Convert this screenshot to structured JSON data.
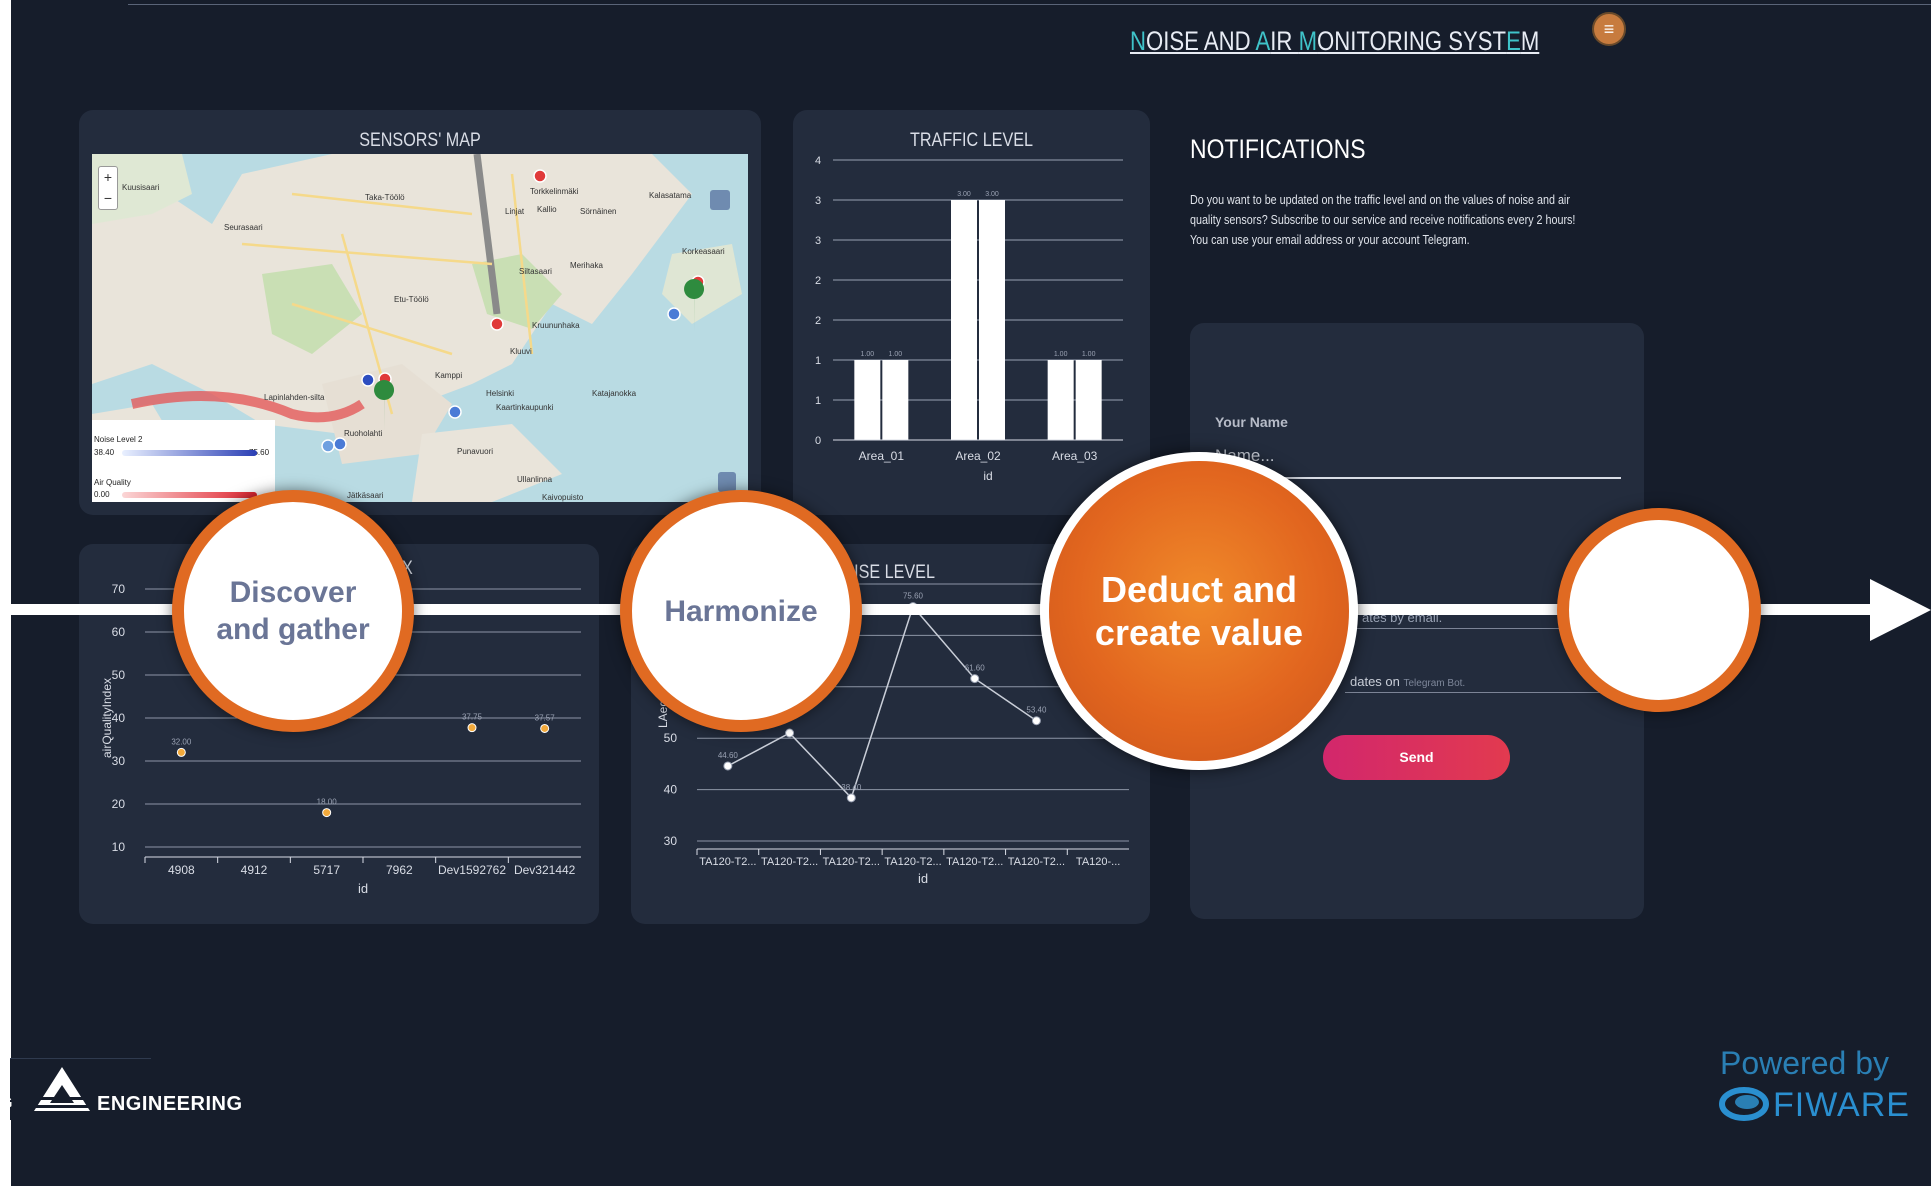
{
  "header": {
    "title_parts": [
      "",
      "N",
      "OISE AND ",
      "A",
      "IR ",
      "M",
      "ONITORING SYST",
      "E",
      "M"
    ],
    "menu_icon": "menu-icon"
  },
  "map_card": {
    "title": "SENSORS' MAP",
    "zoom_in": "+",
    "zoom_out": "−",
    "labels": [
      "Kuusisaari",
      "Taka-Töölö",
      "Torkkelinmäki",
      "Kalasatama",
      "Linjat",
      "Kallio",
      "Sörnäinen",
      "Seurasaari",
      "Etu-Töölö",
      "Siltasaari",
      "Merihaka",
      "Kruununhaka",
      "Kluuvi",
      "Kamppi",
      "Helsinki",
      "Katajanokka",
      "Kaartinkaupunki",
      "Lapinlahden-silta",
      "Ruoholahti",
      "Punavuori",
      "Ullanlinna",
      "Jätkäsaari",
      "Kaivopuisto",
      "Korkeasaari"
    ],
    "legend": {
      "noise_label": "Noise Level 2",
      "noise_min": "38.40",
      "noise_max": "75.60",
      "air_label": "Air Quality",
      "air_min": "0.00"
    }
  },
  "traffic_card": {
    "title": "TRAFFIC LEVEL",
    "xlabel": "id"
  },
  "air_card": {
    "title_visible": "X",
    "xlabel": "id",
    "ylabel": "airQualityIndex"
  },
  "noise_card": {
    "title_visible": "ISE LEVEL",
    "xlabel": "id",
    "ylabel": "LAeq"
  },
  "notifications": {
    "title": "NOTIFICATIONS",
    "text": "Do you want to be updated on the traffic level and on the values of noise and air quality sensors? Subscribe to our service and receive notifications every 2 hours! You can use your email address or your account Telegram.",
    "name_label": "Your Name",
    "name_placeholder": "Name...",
    "email_option": "ates by email.",
    "telegram_option": "dates on",
    "telegram_hint": "Telegram Bot.",
    "send": "Send"
  },
  "process": {
    "step1": "Discover and gather",
    "step2": "Harmonize",
    "step3": "Deduct and create value",
    "step4": ""
  },
  "footer": {
    "engineering": "ENGINEERING",
    "engineering_left": "G",
    "powered_by": "Powered by",
    "fiware": "FIWARE"
  },
  "chart_data": [
    {
      "type": "bar",
      "title": "TRAFFIC LEVEL",
      "xlabel": "id",
      "categories": [
        "Area_01",
        "Area_02",
        "Area_03"
      ],
      "series": [
        {
          "values": [
            1.0,
            3.0,
            1.0
          ]
        },
        {
          "values": [
            1.0,
            3.0,
            1.0
          ]
        }
      ],
      "data_labels": [
        "1.00",
        "1.00",
        "3.00",
        "3.00",
        "1.00",
        "1.00"
      ],
      "yticks": [
        "0",
        "1",
        "1",
        "2",
        "2",
        "3",
        "3",
        "4"
      ],
      "ylim": [
        0,
        3.5
      ]
    },
    {
      "type": "scatter",
      "xlabel": "id",
      "ylabel": "airQualityIndex",
      "categories": [
        "4908",
        "4912",
        "5717",
        "7962",
        "Dev1592762",
        "Dev321442"
      ],
      "values": [
        32.0,
        null,
        18.0,
        null,
        37.75,
        37.57
      ],
      "data_labels": [
        "32.00",
        "",
        "18.00",
        "",
        "37.75",
        "37.57"
      ],
      "yticks": [
        "10",
        "20",
        "30",
        "40",
        "50",
        "60",
        "70"
      ],
      "ylim": [
        10,
        70
      ]
    },
    {
      "type": "line",
      "xlabel": "id",
      "ylabel": "LAeq",
      "categories": [
        "TA120-T2...",
        "TA120-T2...",
        "TA120-T2...",
        "TA120-T2...",
        "TA120-T2...",
        "TA120-T2...",
        "TA120-..."
      ],
      "values": [
        44.6,
        51.0,
        38.4,
        75.6,
        61.6,
        53.4,
        null
      ],
      "data_labels": [
        "44.60",
        "",
        "38.40",
        "75.60",
        "61.60",
        "53.40",
        ""
      ],
      "yticks": [
        "30",
        "40",
        "50"
      ],
      "ylim": [
        30,
        80
      ]
    }
  ],
  "colors": {
    "background": "#161d2b",
    "card": "#232c3d",
    "accent_title": "#3fc3c9",
    "orange": "#e06a22",
    "send_button": "#d92b5e"
  }
}
